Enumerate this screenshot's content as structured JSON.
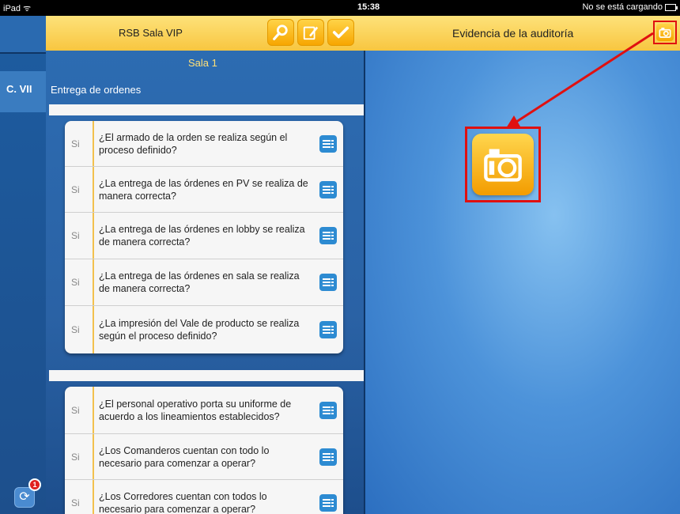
{
  "status_bar": {
    "device": "iPad ᯤ",
    "time": "15:38",
    "charging": "No se está cargando"
  },
  "left_strip": {
    "label": "C. VII",
    "sync_badge": "1"
  },
  "master": {
    "title": "RSB Sala VIP",
    "section_title": "Sala 1",
    "section_name": "Entrega de ordenes",
    "groups": [
      {
        "questions": [
          {
            "answer": "Si",
            "text": "¿El armado de la orden se realiza según el proceso definido?"
          },
          {
            "answer": "Si",
            "text": "¿La entrega de las órdenes en PV se realiza de manera correcta?"
          },
          {
            "answer": "Si",
            "text": "¿La entrega de las órdenes en lobby se realiza de manera correcta?"
          },
          {
            "answer": "Si",
            "text": "¿La entrega de las órdenes en sala se realiza de manera correcta?"
          },
          {
            "answer": "Si",
            "text": "¿La impresión del Vale de producto se realiza según el proceso definido?"
          }
        ]
      },
      {
        "questions": [
          {
            "answer": "Si",
            "text": "¿El personal operativo porta su uniforme de acuerdo a los lineamientos establecidos?"
          },
          {
            "answer": "Si",
            "text": "¿Los Comanderos cuentan con todo lo necesario para comenzar a operar?"
          },
          {
            "answer": "Si",
            "text": "¿Los Corredores cuentan con todos lo necesario para comenzar a operar?"
          }
        ]
      }
    ]
  },
  "detail": {
    "title": "Evidencia de la auditoría"
  },
  "colors": {
    "header_yellow": "#f8c640",
    "accent_orange": "#f7a600",
    "highlight_red": "#e01010",
    "panel_blue": "#2a62a5"
  }
}
